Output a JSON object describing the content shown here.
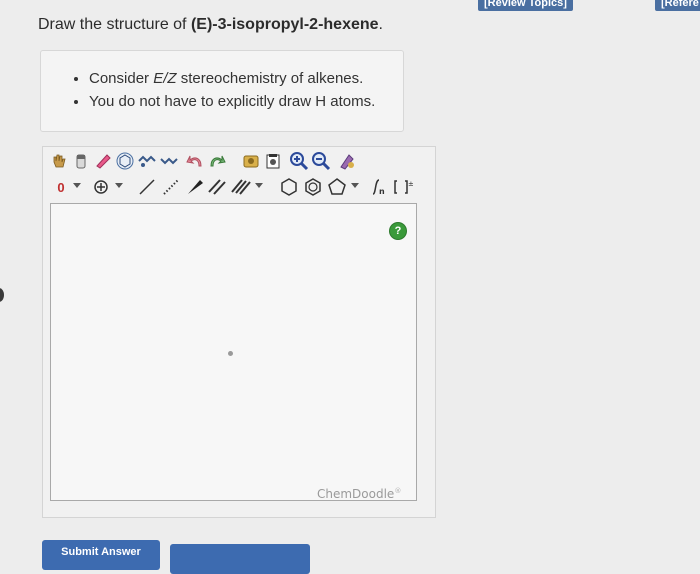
{
  "header": {
    "review_topics": "[Review Topics]",
    "references": "[Refere"
  },
  "question": {
    "prefix": "Draw the structure of ",
    "compound": "(E)-3-isopropyl-2-hexene",
    "suffix": "."
  },
  "hints": {
    "items": [
      {
        "before": "Consider ",
        "em": "E/Z",
        "after": " stereochemistry of alkenes."
      },
      {
        "before": "You do not have to explicitly draw H atoms.",
        "em": "",
        "after": ""
      }
    ]
  },
  "sketcher": {
    "charge_label": "0",
    "help_label": "?",
    "brand": "ChemDoodle",
    "brand_mark": "®",
    "brand_partial": "",
    "toolbar_row1": [
      "hand-icon",
      "eraser-icon",
      "lasso-icon",
      "ring-template-icon",
      "chain-icon",
      "undo-icon",
      "redo-icon",
      "clipboard-icon",
      "clear-icon",
      "zoom-in-icon",
      "zoom-out-icon",
      "clean-icon"
    ],
    "toolbar_row2": [
      "charge-dropdown",
      "radical-icon",
      "single-bond-icon",
      "wedge-bond-icon",
      "double-bond-icon",
      "triple-bond-icon",
      "benzene-icon",
      "cyclohexane-icon",
      "cyclopentane-icon",
      "bracket-icon"
    ]
  },
  "footer": {
    "submit_label": "Submit Answer"
  },
  "colors": {
    "accent": "#3d6bb0",
    "help": "#3a9a3a"
  }
}
